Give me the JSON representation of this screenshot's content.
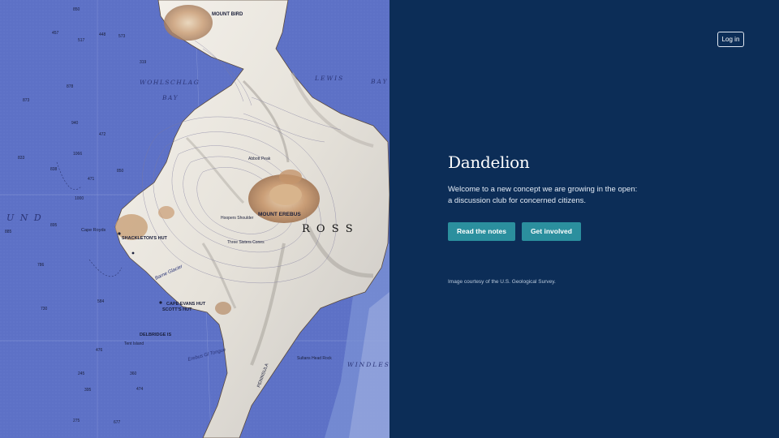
{
  "header": {
    "login_label": "Log in"
  },
  "hero": {
    "title": "Dandelion",
    "text_line1": "Welcome to a new concept we are growing in the open:",
    "text_line2": "a discussion club for concerned citizens.",
    "primary_button": "Read the notes",
    "secondary_button": "Get involved",
    "credit": "Image courtesy of the U.S. Geological Survey."
  },
  "map": {
    "labels": {
      "mount_bird": "MOUNT BIRD",
      "wohlschlag": "WOHLSCHLAG",
      "bay": "BAY",
      "lewis": "LEWIS",
      "bay2": "BAY",
      "sound": "U N D",
      "cape_royds": "Cape Royds",
      "shackleton": "SHACKLETON'S HUT",
      "mount_erebus": "MOUNT EREBUS",
      "ross": "R O S S",
      "cape_evans": "CAPE EVANS HUT",
      "scott": "SCOTT'S HUT",
      "delbridge": "DELBRIDGE IS",
      "barne": "Barne Glacier",
      "windless": "WINDLESS",
      "hoopers": "Hoopers Shoulder",
      "three_sisters": "Three Sisters Cones",
      "abbott": "Abbott Peak",
      "peninsula": "PENINSULA",
      "sultans": "Sultans Head Rock",
      "erebus_tongue": "Erebus Gl Tongue",
      "tent_island": "Tent Island"
    },
    "depths": [
      "850",
      "457",
      "448",
      "573",
      "517",
      "878",
      "873",
      "940",
      "472",
      "833",
      "1066",
      "838",
      "471",
      "850",
      "1000",
      "895",
      "885",
      "786",
      "730",
      "584",
      "476",
      "245",
      "360",
      "474",
      "319",
      "395",
      "677",
      "275"
    ]
  }
}
